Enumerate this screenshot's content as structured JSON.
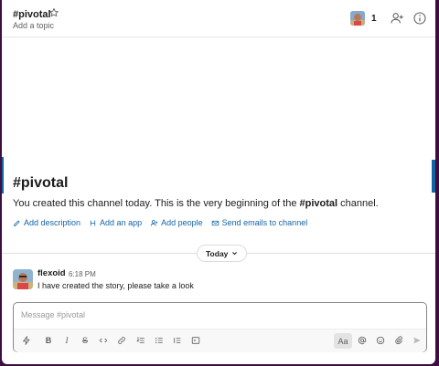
{
  "header": {
    "channel_name": "#pivotal",
    "topic_placeholder": "Add a topic",
    "member_count": "1"
  },
  "intro": {
    "title": "#pivotal",
    "text_before": "You created this channel today. This is the very beginning of the ",
    "channel_bold": "#pivotal",
    "text_after": " channel.",
    "actions": [
      {
        "label": "Add description",
        "icon": "pencil-icon"
      },
      {
        "label": "Add an app",
        "icon": "app-icon"
      },
      {
        "label": "Add people",
        "icon": "add-person-icon"
      },
      {
        "label": "Send emails to channel",
        "icon": "email-icon"
      }
    ]
  },
  "day_divider": {
    "label": "Today"
  },
  "message": {
    "author": "flexoid",
    "time": "6:18 PM",
    "text": "I have created the story, please take a look"
  },
  "composer": {
    "placeholder": "Message #pivotal",
    "format_button": "Aa"
  },
  "colors": {
    "link": "#1264a3",
    "sidebar": "#3f0e40"
  }
}
